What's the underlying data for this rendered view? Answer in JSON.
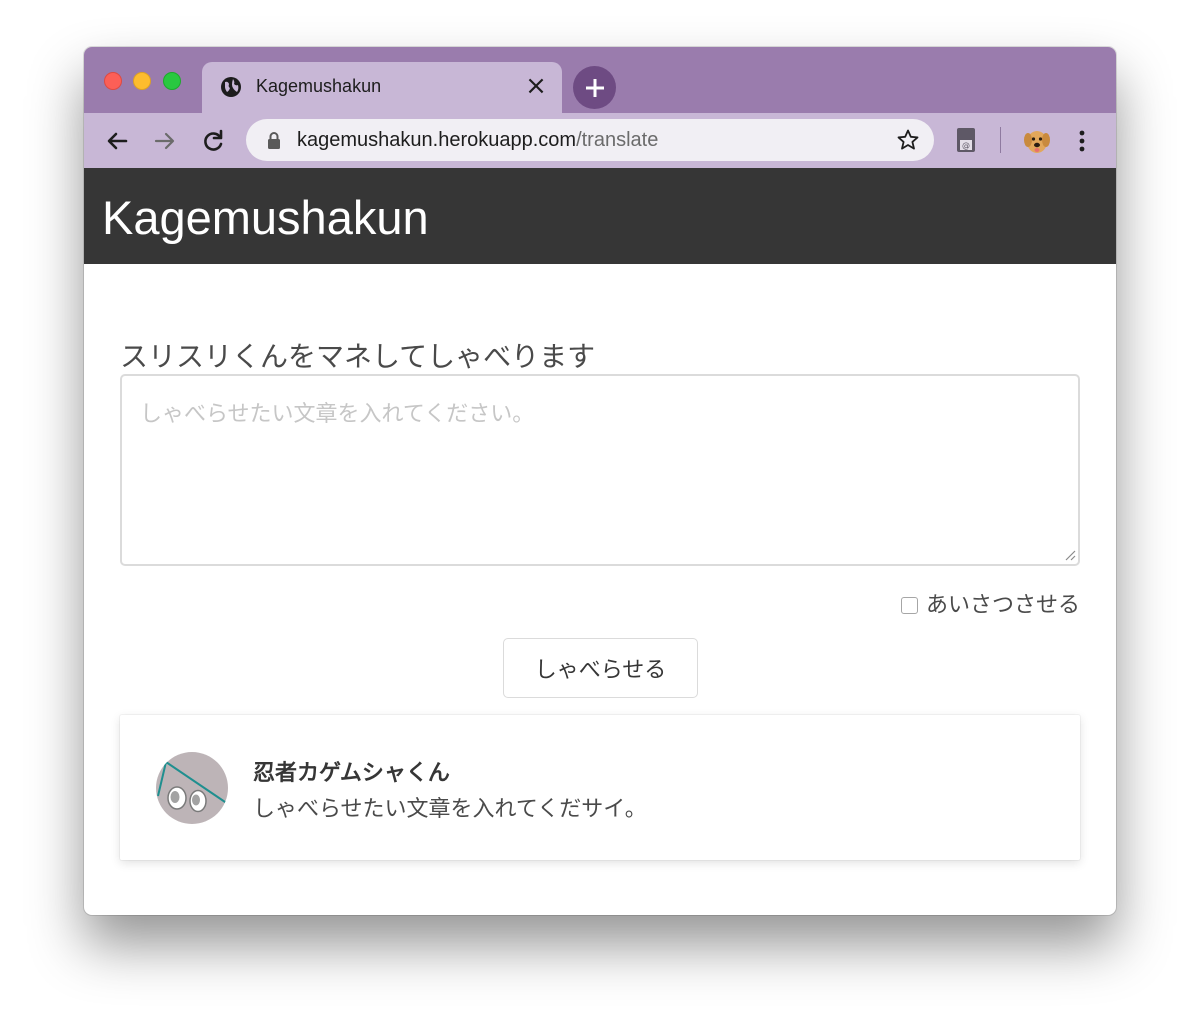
{
  "browser": {
    "tab_title": "Kagemushakun",
    "tab_close": "×",
    "url_host": "kagemushakun.herokuapp.com",
    "url_path": "/translate",
    "accent_color": "#9a7cad",
    "toolbar_color": "#c8b7d6",
    "newtab_color": "#6e4b83"
  },
  "header": {
    "brand": "Kagemushakun",
    "background": "#363636"
  },
  "form": {
    "label": "スリスリくんをマネしてしゃべります",
    "textarea_placeholder": "しゃべらせたい文章を入れてください。",
    "textarea_value": "",
    "greeting_checkbox_label": "あいさつさせる",
    "greeting_checked": false,
    "submit_label": "しゃべらせる"
  },
  "response": {
    "speaker_name": "忍者カゲムシャくん",
    "message": "しゃべらせたい文章を入れてくだサイ。",
    "avatar_icon": "ninja-avatar-icon"
  }
}
